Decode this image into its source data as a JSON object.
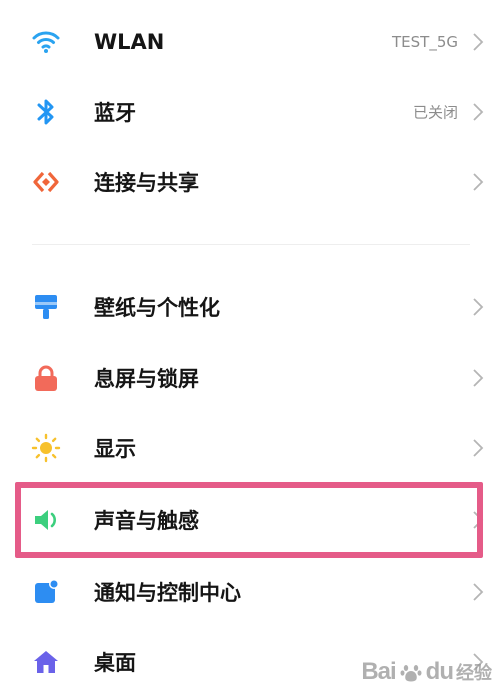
{
  "colors": {
    "wifi": "#2aa3f0",
    "bluetooth": "#2396f3",
    "share": "#f0663a",
    "wallpaper": "#2d8df2",
    "lock": "#f26a5a",
    "display": "#f7c12c",
    "sound": "#3ccf7e",
    "notification": "#2d8df2",
    "home": "#6a62e9",
    "highlight": "#e55b88"
  },
  "settings": {
    "items": [
      {
        "icon": "wifi-icon",
        "label": "WLAN",
        "value": "TEST_5G"
      },
      {
        "icon": "bluetooth-icon",
        "label": "蓝牙",
        "value": "已关闭"
      },
      {
        "icon": "share-icon",
        "label": "连接与共享",
        "value": ""
      },
      {
        "icon": "wallpaper-icon",
        "label": "壁纸与个性化",
        "value": ""
      },
      {
        "icon": "lock-icon",
        "label": "息屏与锁屏",
        "value": ""
      },
      {
        "icon": "sun-icon",
        "label": "显示",
        "value": ""
      },
      {
        "icon": "speaker-icon",
        "label": "声音与触感",
        "value": ""
      },
      {
        "icon": "notification-icon",
        "label": "通知与控制中心",
        "value": ""
      },
      {
        "icon": "home-icon",
        "label": "桌面",
        "value": ""
      }
    ]
  },
  "watermark": {
    "brand": "Bai",
    "brand2": "du",
    "suffix": "经验"
  }
}
